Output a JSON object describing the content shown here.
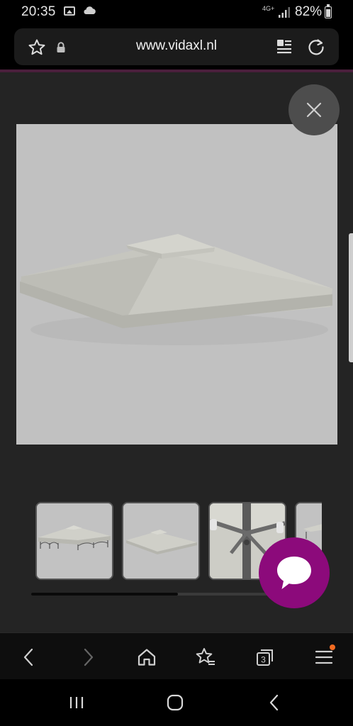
{
  "status_bar": {
    "time": "20:35",
    "network": "4G+",
    "battery": "82%",
    "icons": [
      "image-icon",
      "cloud-icon",
      "signal-icon",
      "battery-icon"
    ]
  },
  "browser": {
    "url": "www.vidaxl.nl",
    "icons": [
      "bookmark-star-icon",
      "lock-icon",
      "reader-mode-icon",
      "reload-icon"
    ]
  },
  "gallery": {
    "main_image": "gazebo-roof-cover",
    "thumbnails": [
      {
        "name": "gazebo-full-view"
      },
      {
        "name": "gazebo-roof-cover"
      },
      {
        "name": "gazebo-frame-detail"
      },
      {
        "name": "gazebo-partial"
      }
    ],
    "scroll_fraction": 0.56
  },
  "toolbar": {
    "tab_count": "3",
    "buttons": [
      "back",
      "forward",
      "home",
      "bookmarks",
      "tabs",
      "menu"
    ]
  },
  "colors": {
    "overlay": "#242424",
    "chat_accent": "#8c0a7b",
    "menu_badge": "#f36b21",
    "image_bg": "#c1c1c1"
  }
}
